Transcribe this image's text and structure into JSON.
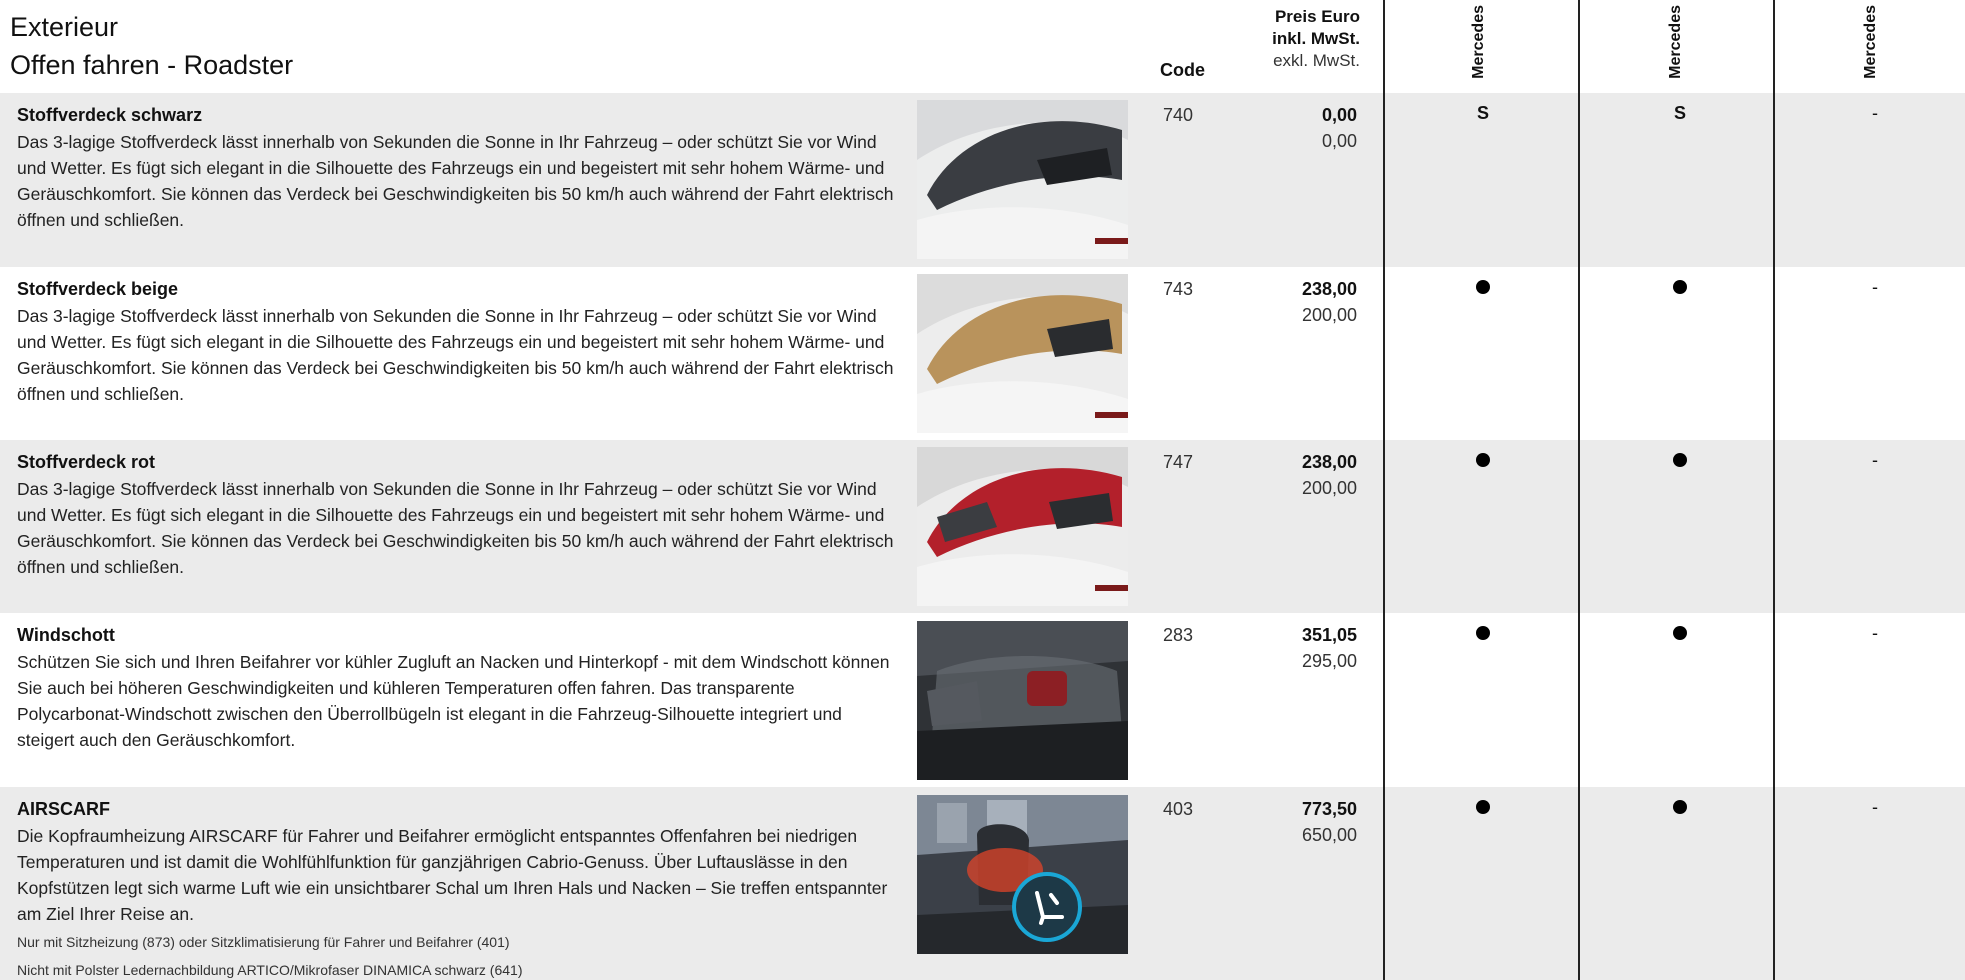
{
  "header": {
    "title_line1": "Exterieur",
    "title_line2": "Offen fahren - Roadster",
    "code_label": "Code",
    "price_line1": "Preis Euro",
    "price_line2": "inkl. MwSt.",
    "price_line3": "exkl. MwSt.",
    "models": [
      "Mercedes",
      "Mercedes",
      "Mercedes"
    ]
  },
  "options": [
    {
      "name": "Stoffverdeck schwarz",
      "description": "Das 3-lagige Stoffverdeck lässt innerhalb von Sekunden die Sonne in Ihr Fahrzeug – oder schützt Sie vor Wind und Wetter. Es fügt sich elegant in die Silhouette des Fahrzeugs ein und begeistert mit sehr hohem Wärme- und Geräuschkomfort. Sie können das Verdeck bei Geschwindigkeiten bis 50 km/h auch während der Fahrt elektrisch öffnen und schließen.",
      "code": "740",
      "price_inkl": "0,00",
      "price_exkl": "0,00",
      "availability": [
        "S",
        "S",
        "-"
      ],
      "image": "roof-black"
    },
    {
      "name": "Stoffverdeck beige",
      "description": "Das 3-lagige Stoffverdeck lässt innerhalb von Sekunden die Sonne in Ihr Fahrzeug – oder schützt Sie vor Wind und Wetter. Es fügt sich elegant in die Silhouette des Fahrzeugs ein und begeistert mit sehr hohem Wärme- und Geräuschkomfort. Sie können das Verdeck bei Geschwindigkeiten bis 50 km/h auch während der Fahrt elektrisch öffnen und schließen.",
      "code": "743",
      "price_inkl": "238,00",
      "price_exkl": "200,00",
      "availability": [
        "●",
        "●",
        "-"
      ],
      "image": "roof-beige"
    },
    {
      "name": "Stoffverdeck rot",
      "description": "Das 3-lagige Stoffverdeck lässt innerhalb von Sekunden die Sonne in Ihr Fahrzeug – oder schützt Sie vor Wind und Wetter. Es fügt sich elegant in die Silhouette des Fahrzeugs ein und begeistert mit sehr hohem Wärme- und Geräuschkomfort. Sie können das Verdeck bei Geschwindigkeiten bis 50 km/h auch während der Fahrt elektrisch öffnen und schließen.",
      "code": "747",
      "price_inkl": "238,00",
      "price_exkl": "200,00",
      "availability": [
        "●",
        "●",
        "-"
      ],
      "image": "roof-red"
    },
    {
      "name": "Windschott",
      "description": "Schützen Sie sich und Ihren Beifahrer vor kühler Zugluft an Nacken und Hinterkopf - mit dem Windschott können Sie auch bei höheren Geschwindigkeiten und kühleren Temperaturen offen fahren. Das transparente Polycarbonat-Windschott zwischen den Überrollbügeln ist elegant in die Fahrzeug-Silhouette integriert und steigert auch den Geräuschkomfort.",
      "code": "283",
      "price_inkl": "351,05",
      "price_exkl": "295,00",
      "availability": [
        "●",
        "●",
        "-"
      ],
      "image": "windschott"
    },
    {
      "name": "AIRSCARF",
      "description": "Die Kopfraumheizung AIRSCARF für Fahrer und Beifahrer ermöglicht entspanntes Offenfahren bei niedrigen Temperaturen und ist damit die Wohlfühlfunktion für ganzjährigen Cabrio-Genuss. Über Luftauslässe in den Kopfstützen legt sich warme Luft wie ein unsichtbarer Schal um Ihren Hals und Nacken – Sie treffen entspannter am Ziel Ihrer Reise an.",
      "note1": "Nur mit Sitzheizung (873) oder Sitzklimatisierung für Fahrer und Beifahrer (401)",
      "note2": "Nicht mit Polster Ledernachbildung ARTICO/Mikrofaser DINAMICA schwarz (641)",
      "code": "403",
      "price_inkl": "773,50",
      "price_exkl": "650,00",
      "availability": [
        "●",
        "●",
        "-"
      ],
      "image": "airscarf"
    }
  ],
  "colors": {
    "row_shade": "#ebebeb",
    "roof_black": "#3a3d42",
    "roof_beige": "#b9935c",
    "roof_red": "#b3202b",
    "airscarf_glow": "#e0442a",
    "icon_ring": "#1aa7d6"
  }
}
